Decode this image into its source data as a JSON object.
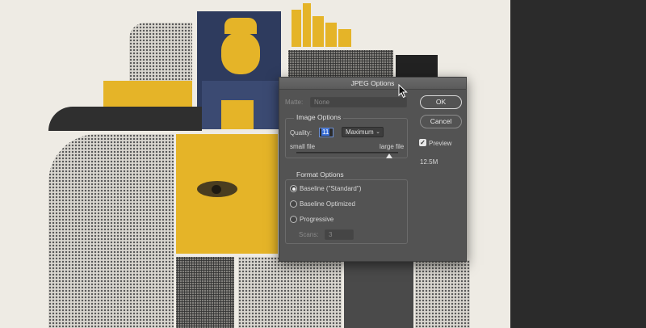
{
  "dialog": {
    "title": "JPEG Options",
    "matte_label": "Matte:",
    "matte_value": "None",
    "image_options": {
      "heading": "Image Options",
      "quality_label": "Quality:",
      "quality_value": "11",
      "quality_preset": "Maximum",
      "small_file_label": "small file",
      "large_file_label": "large file",
      "slider_level": 0.91
    },
    "format_options": {
      "heading": "Format Options",
      "options": [
        "Baseline (\"Standard\")",
        "Baseline Optimized",
        "Progressive"
      ],
      "selected_index": 0,
      "scans_label": "Scans:",
      "scans_value": "3"
    },
    "ok_label": "OK",
    "cancel_label": "Cancel",
    "preview_label": "Preview",
    "preview_checked": true,
    "file_size": "12.5M"
  },
  "colors": {
    "canvas": "#eeebe4",
    "accent_yellow": "#e5b428",
    "accent_navy": "#2e3b5e",
    "dialog_bg": "#535353"
  },
  "icons": [
    "mouse-cursor-icon",
    "chevron-down-icon",
    "checkmark-icon"
  ]
}
